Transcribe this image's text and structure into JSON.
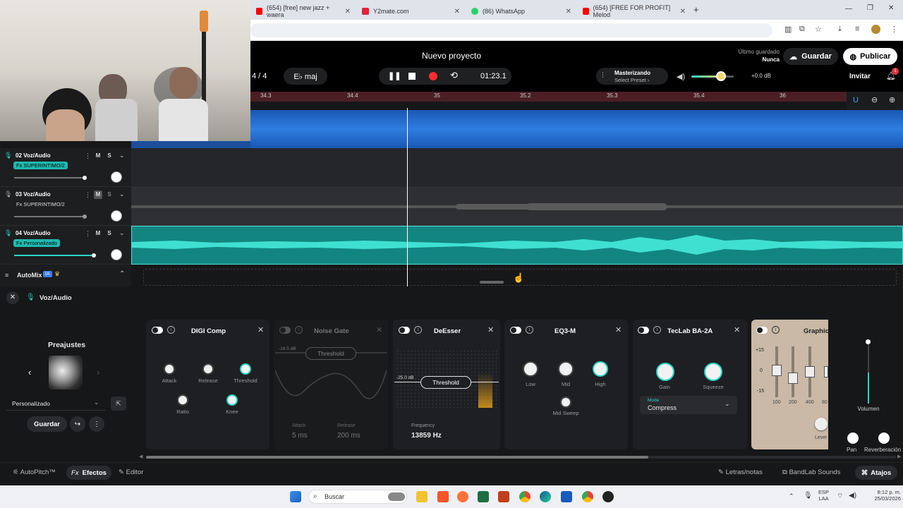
{
  "browser": {
    "tabs": [
      {
        "title": "(654) [free] new jazz + waera",
        "color": "#ff0000"
      },
      {
        "title": "Y2mate.com",
        "color": "#e0223a"
      },
      {
        "title": "(86) WhatsApp",
        "color": "#25d366"
      },
      {
        "title": "(654) [FREE FOR PROFIT] Melod",
        "color": "#ff0000"
      }
    ],
    "new_tab": "+"
  },
  "header": {
    "project_title": "Nuevo proyecto",
    "time_sig": "4 / 4",
    "key": "E♭ maj",
    "time": "01:23.1",
    "mastering_label": "Masterizando",
    "mastering_preset": "Select Preset ›",
    "gain": "+0.0 dB",
    "last_saved_label": "Último guardado",
    "last_saved_value": "Nunca",
    "save": "Guardar",
    "publish": "Publicar",
    "invite": "Invitar",
    "notif_count": "1"
  },
  "timeline": {
    "ticks": [
      "34.3",
      "34.4",
      "35",
      "35.2",
      "35.3",
      "35.4",
      "36"
    ]
  },
  "tracks": [
    {
      "name": "02 Voz/Audio",
      "fx": "Fx SUPERINTIMO/2",
      "color": "#2a2c30"
    },
    {
      "name": "03 Voz/Audio",
      "fx": "Fx SUPERINTIMO/2",
      "color": "#2f3033"
    },
    {
      "name": "04 Voz/Audio",
      "fx": "Fx Personalizado",
      "color": "#1a8f8a"
    }
  ],
  "ms": {
    "m": "M",
    "s": "S"
  },
  "automix": {
    "label": "AutoMix",
    "badge": "IA"
  },
  "fx_panel": {
    "track": "Voz/Audio",
    "presets_title": "Preajustes",
    "preset_name": "Personalizado",
    "save": "Guardar",
    "digicomp": {
      "title": "DIGI Comp",
      "attack": "Attack",
      "release": "Release",
      "threshold": "Threshold",
      "ratio": "Ratio",
      "knee": "Knee"
    },
    "noisegate": {
      "title": "Noise Gate",
      "db": "-18.5 dB",
      "threshold": "Threshold",
      "attack_label": "Attack",
      "attack": "5 ms",
      "release_label": "Release",
      "release": "200 ms"
    },
    "deesser": {
      "title": "DeEsser",
      "db": "-25.0 dB",
      "threshold": "Threshold",
      "freq_label": "Frequency",
      "freq": "13859 Hz"
    },
    "eq3": {
      "title": "EQ3-M",
      "low": "Low",
      "mid": "Mid",
      "high": "High",
      "sweep": "Mid Sweep"
    },
    "teclab": {
      "title": "TecLab BA-2A",
      "gain": "Gain",
      "squeeze": "Squeeze",
      "mode_label": "Mode",
      "mode": "Compress"
    },
    "graphic": {
      "title": "Graphic",
      "scale": [
        "+15",
        "0",
        "-15"
      ],
      "bands": [
        "100",
        "200",
        "400",
        "80"
      ],
      "level": "Level"
    },
    "volume": "Volumen",
    "pan": "Pan",
    "reverb": "Reverberación"
  },
  "footer": {
    "autopitch": "AutoPitch™",
    "effects": "Efectos",
    "editor": "Editor",
    "lyrics": "Letras/notas",
    "sounds": "BandLab Sounds",
    "shortcuts": "Atajos"
  },
  "taskbar": {
    "search": "Buscar",
    "lang1": "ESP",
    "lang2": "LAA",
    "time": "8:12 p. m.",
    "date": "25/03/2026"
  }
}
